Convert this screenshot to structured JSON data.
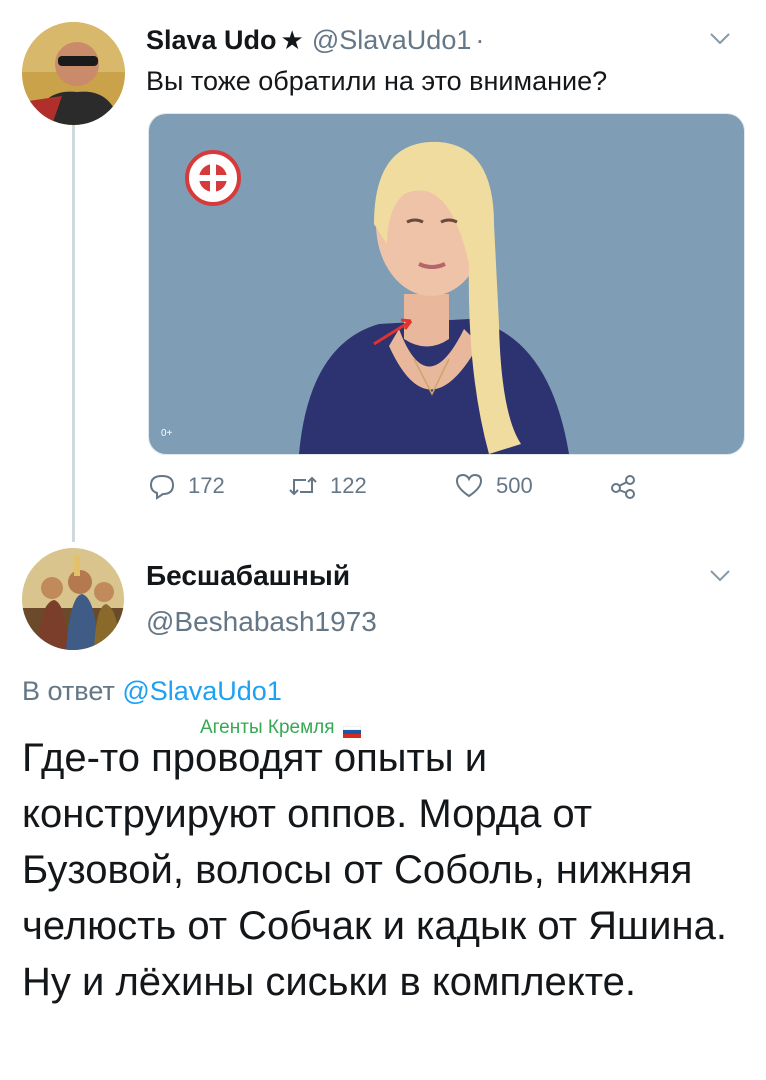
{
  "tweet1": {
    "display_name": "Slava Udo",
    "star": "★",
    "handle": "@SlavaUdo1",
    "separator": "·",
    "text": "Вы тоже обратили на это внимание?",
    "media": {
      "corner_mark": "0+"
    },
    "actions": {
      "reply_count": "172",
      "retweet_count": "122",
      "like_count": "500"
    }
  },
  "tweet2": {
    "display_name": "Бесшабашный",
    "handle": "@Beshabash1973",
    "reply_prefix": "В ответ",
    "reply_mention": "@SlavaUdo1",
    "badge": "Агенты Кремля",
    "text": "Где-то проводят опыты и конструируют оппов. Морда от Бузовой, волосы от Соболь, нижняя челюсть от Собчак и кадык от Яшина. Ну и лёхины сиськи в комплекте."
  },
  "colors": {
    "text_primary": "#14171a",
    "text_secondary": "#657786",
    "mention": "#1da1f2",
    "badge_green": "#37a852",
    "thread_line": "#cfd9de",
    "media_background": "#7f9db4"
  },
  "icons": [
    "chevron-down-icon",
    "reply-icon",
    "retweet-icon",
    "like-icon",
    "share-icon",
    "russia-flag-icon",
    "channel-logo-icon"
  ]
}
